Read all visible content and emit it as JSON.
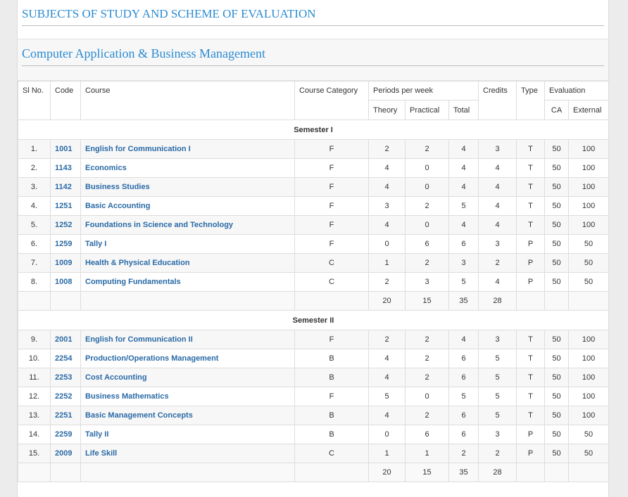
{
  "page_title": "SUBJECTS OF STUDY AND SCHEME OF EVALUATION",
  "program_title": "Computer Application & Business Management",
  "headers": {
    "sl_no": "Sl No.",
    "code": "Code",
    "course": "Course",
    "course_category": "Course Category",
    "periods_per_week": "Periods per week",
    "credits": "Credits",
    "type": "Type",
    "evaluation": "Evaluation",
    "theory": "Theory",
    "practical": "Practical",
    "total": "Total",
    "ca": "CA",
    "external": "External"
  },
  "semesters": [
    {
      "label": "Semester I",
      "rows": [
        {
          "sl": "1.",
          "code": "1001",
          "course": "English for Communication I",
          "cat": "F",
          "theory": "2",
          "practical": "2",
          "total": "4",
          "credits": "3",
          "type": "T",
          "ca": "50",
          "ext": "100"
        },
        {
          "sl": "2.",
          "code": "1143",
          "course": "Economics",
          "cat": "F",
          "theory": "4",
          "practical": "0",
          "total": "4",
          "credits": "4",
          "type": "T",
          "ca": "50",
          "ext": "100"
        },
        {
          "sl": "3.",
          "code": "1142",
          "course": "Business Studies",
          "cat": "F",
          "theory": "4",
          "practical": "0",
          "total": "4",
          "credits": "4",
          "type": "T",
          "ca": "50",
          "ext": "100"
        },
        {
          "sl": "4.",
          "code": "1251",
          "course": "Basic Accounting",
          "cat": "F",
          "theory": "3",
          "practical": "2",
          "total": "5",
          "credits": "4",
          "type": "T",
          "ca": "50",
          "ext": "100"
        },
        {
          "sl": "5.",
          "code": "1252",
          "course": "Foundations in Science and Technology",
          "cat": "F",
          "theory": "4",
          "practical": "0",
          "total": "4",
          "credits": "4",
          "type": "T",
          "ca": "50",
          "ext": "100"
        },
        {
          "sl": "6.",
          "code": "1259",
          "course": "Tally I",
          "cat": "F",
          "theory": "0",
          "practical": "6",
          "total": "6",
          "credits": "3",
          "type": "P",
          "ca": "50",
          "ext": "50"
        },
        {
          "sl": "7.",
          "code": "1009",
          "course": "Health & Physical Education",
          "cat": "C",
          "theory": "1",
          "practical": "2",
          "total": "3",
          "credits": "2",
          "type": "P",
          "ca": "50",
          "ext": "50"
        },
        {
          "sl": "8.",
          "code": "1008",
          "course": "Computing Fundamentals",
          "cat": "C",
          "theory": "2",
          "practical": "3",
          "total": "5",
          "credits": "4",
          "type": "P",
          "ca": "50",
          "ext": "50"
        }
      ],
      "totals": {
        "theory": "20",
        "practical": "15",
        "total": "35",
        "credits": "28"
      }
    },
    {
      "label": "Semester II",
      "rows": [
        {
          "sl": "9.",
          "code": "2001",
          "course": "English for Communication II",
          "cat": "F",
          "theory": "2",
          "practical": "2",
          "total": "4",
          "credits": "3",
          "type": "T",
          "ca": "50",
          "ext": "100"
        },
        {
          "sl": "10.",
          "code": "2254",
          "course": "Production/Operations Management",
          "cat": "B",
          "theory": "4",
          "practical": "2",
          "total": "6",
          "credits": "5",
          "type": "T",
          "ca": "50",
          "ext": "100"
        },
        {
          "sl": "11.",
          "code": "2253",
          "course": "Cost Accounting",
          "cat": "B",
          "theory": "4",
          "practical": "2",
          "total": "6",
          "credits": "5",
          "type": "T",
          "ca": "50",
          "ext": "100"
        },
        {
          "sl": "12.",
          "code": "2252",
          "course": "Business Mathematics",
          "cat": "F",
          "theory": "5",
          "practical": "0",
          "total": "5",
          "credits": "5",
          "type": "T",
          "ca": "50",
          "ext": "100"
        },
        {
          "sl": "13.",
          "code": "2251",
          "course": "Basic Management Concepts",
          "cat": "B",
          "theory": "4",
          "practical": "2",
          "total": "6",
          "credits": "5",
          "type": "T",
          "ca": "50",
          "ext": "100"
        },
        {
          "sl": "14.",
          "code": "2259",
          "course": "Tally II",
          "cat": "B",
          "theory": "0",
          "practical": "6",
          "total": "6",
          "credits": "3",
          "type": "P",
          "ca": "50",
          "ext": "50"
        },
        {
          "sl": "15.",
          "code": "2009",
          "course": "Life Skill",
          "cat": "C",
          "theory": "1",
          "practical": "1",
          "total": "2",
          "credits": "2",
          "type": "P",
          "ca": "50",
          "ext": "50"
        }
      ],
      "totals": {
        "theory": "20",
        "practical": "15",
        "total": "35",
        "credits": "28"
      }
    }
  ]
}
